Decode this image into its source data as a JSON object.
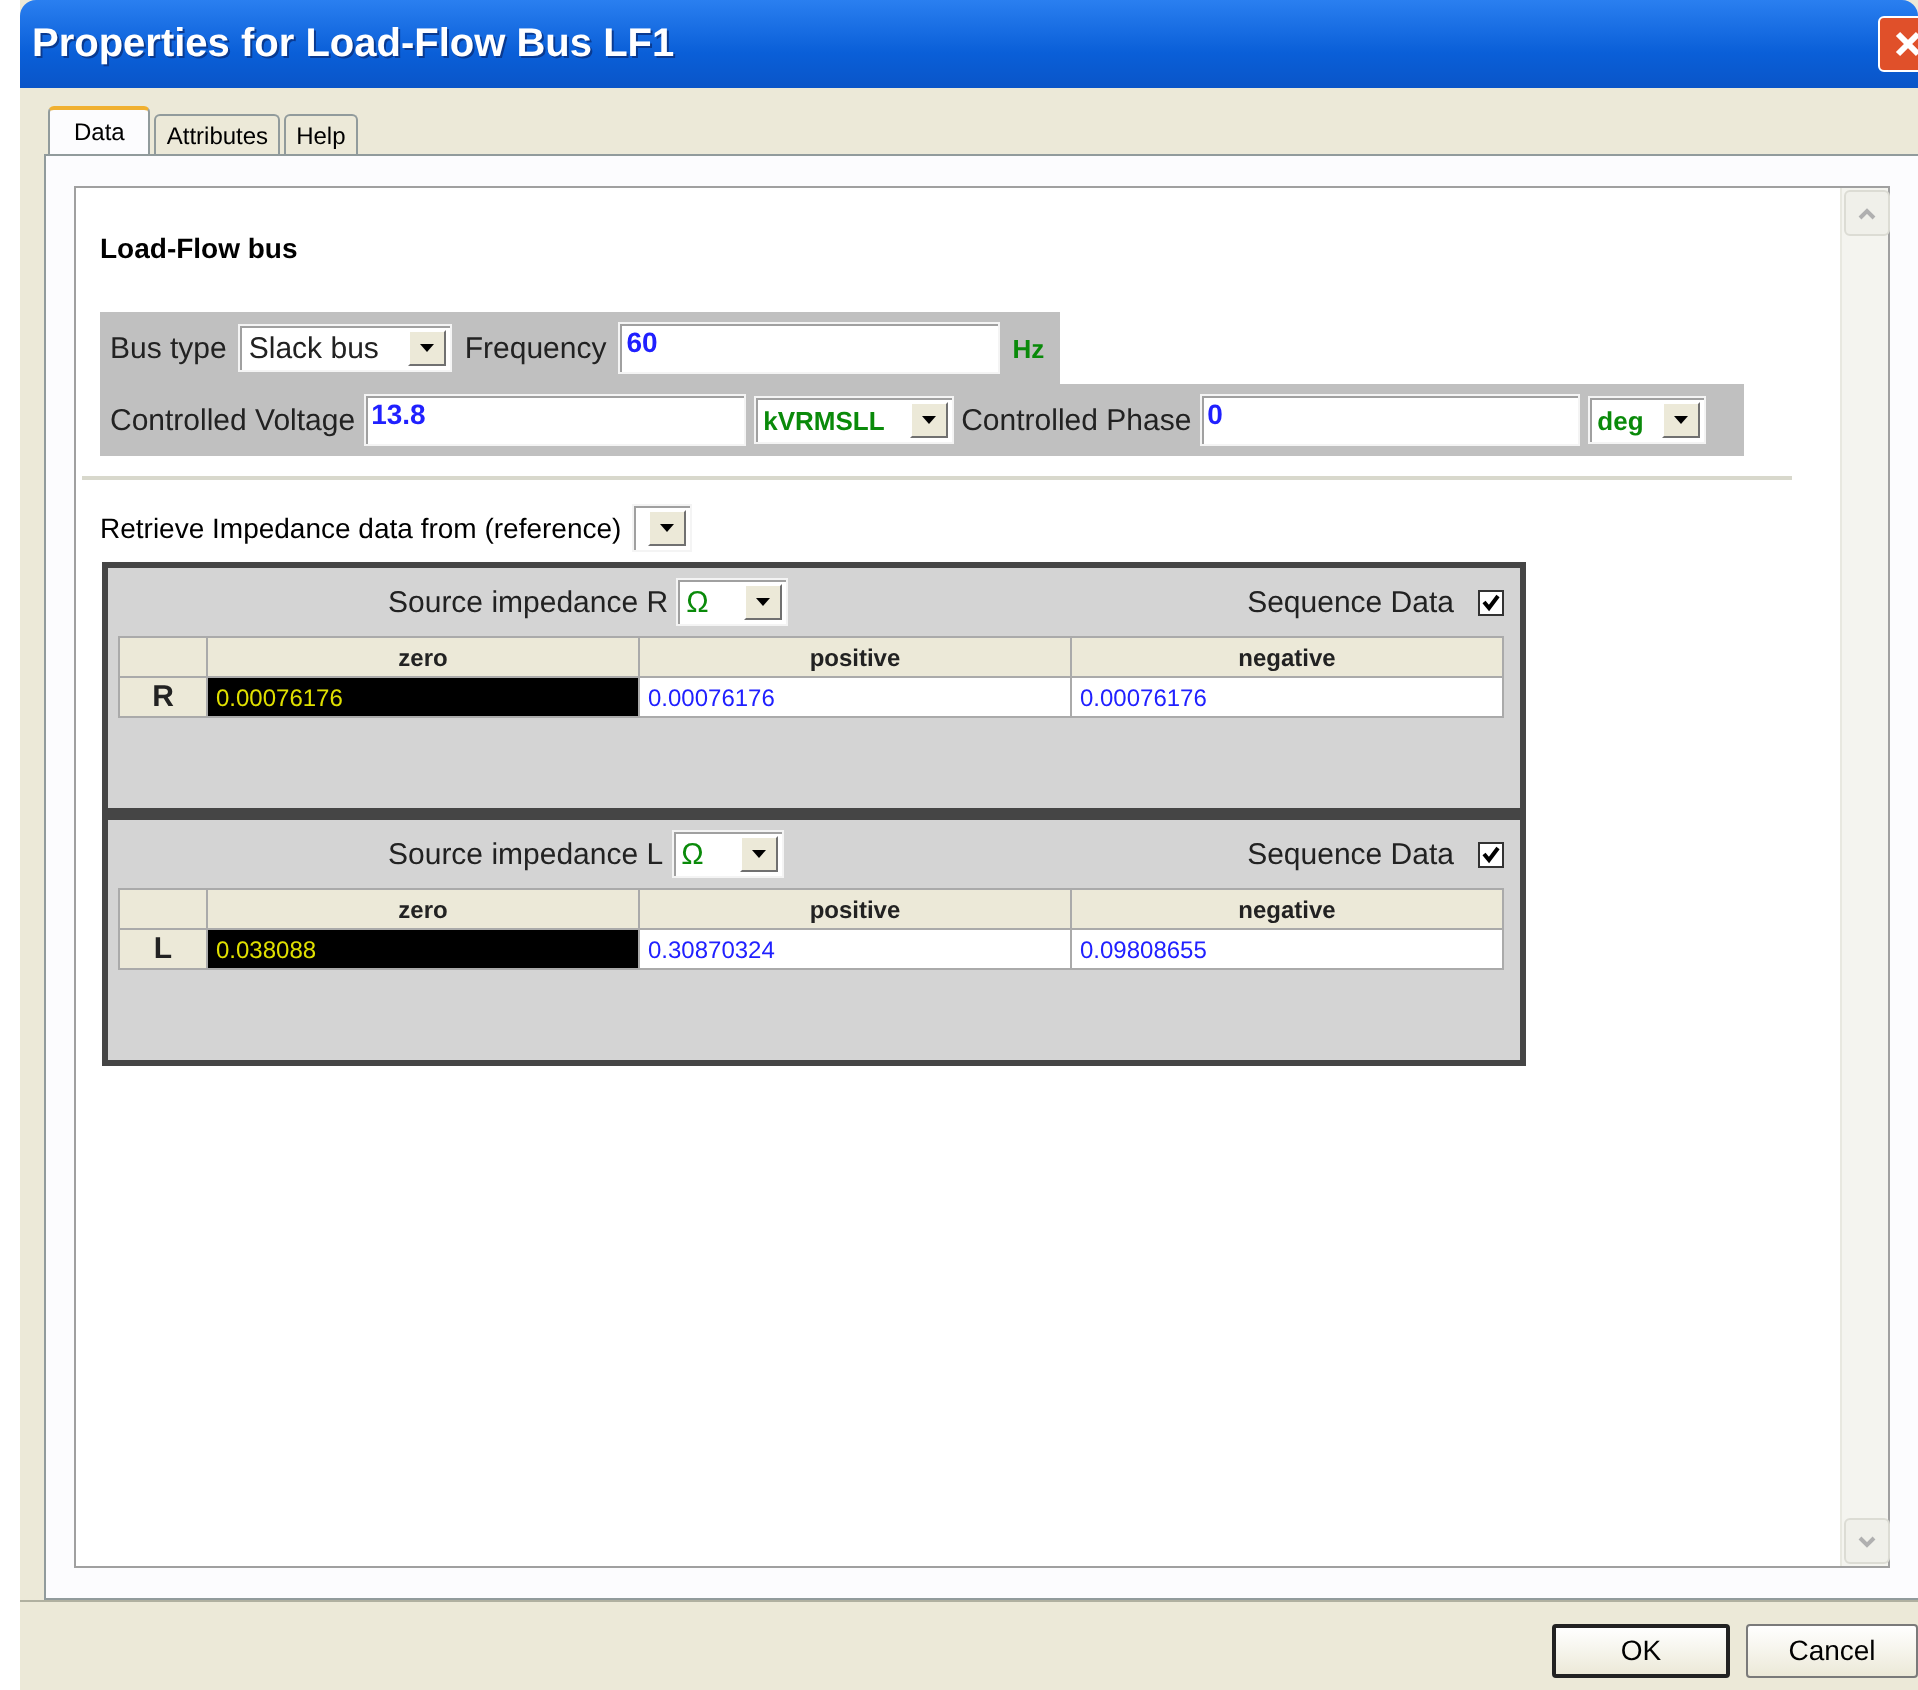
{
  "window": {
    "title": "Properties for Load-Flow Bus LF1"
  },
  "tabs": [
    {
      "label": "Data",
      "selected": true
    },
    {
      "label": "Attributes",
      "selected": false
    },
    {
      "label": "Help",
      "selected": false
    }
  ],
  "section_title": "Load-Flow bus",
  "bus_type": {
    "label": "Bus type",
    "value": "Slack bus"
  },
  "frequency": {
    "label": "Frequency",
    "value": "60",
    "unit": "Hz"
  },
  "controlled_voltage": {
    "label": "Controlled Voltage",
    "value": "13.8",
    "unit": "kVRMSLL"
  },
  "controlled_phase": {
    "label": "Controlled Phase",
    "value": "0",
    "unit": "deg"
  },
  "retrieve": {
    "label": "Retrieve Impedance data from (reference)"
  },
  "impedances": [
    {
      "label": "Source impedance R",
      "unit": "Ω",
      "sequence_label": "Sequence Data",
      "checked": true,
      "columns": [
        "zero",
        "positive",
        "negative"
      ],
      "row_label": "R",
      "cells": [
        {
          "value": "0.00076176",
          "selected": true
        },
        {
          "value": "0.00076176",
          "selected": false
        },
        {
          "value": "0.00076176",
          "selected": false
        }
      ]
    },
    {
      "label": "Source impedance L",
      "unit": "Ω",
      "sequence_label": "Sequence Data",
      "checked": true,
      "columns": [
        "zero",
        "positive",
        "negative"
      ],
      "row_label": "L",
      "cells": [
        {
          "value": "0.038088",
          "selected": true
        },
        {
          "value": "0.30870324",
          "selected": false
        },
        {
          "value": "0.09808655",
          "selected": false
        }
      ]
    }
  ],
  "buttons": [
    {
      "label": "OK",
      "default": true
    },
    {
      "label": "Cancel",
      "default": false
    }
  ]
}
